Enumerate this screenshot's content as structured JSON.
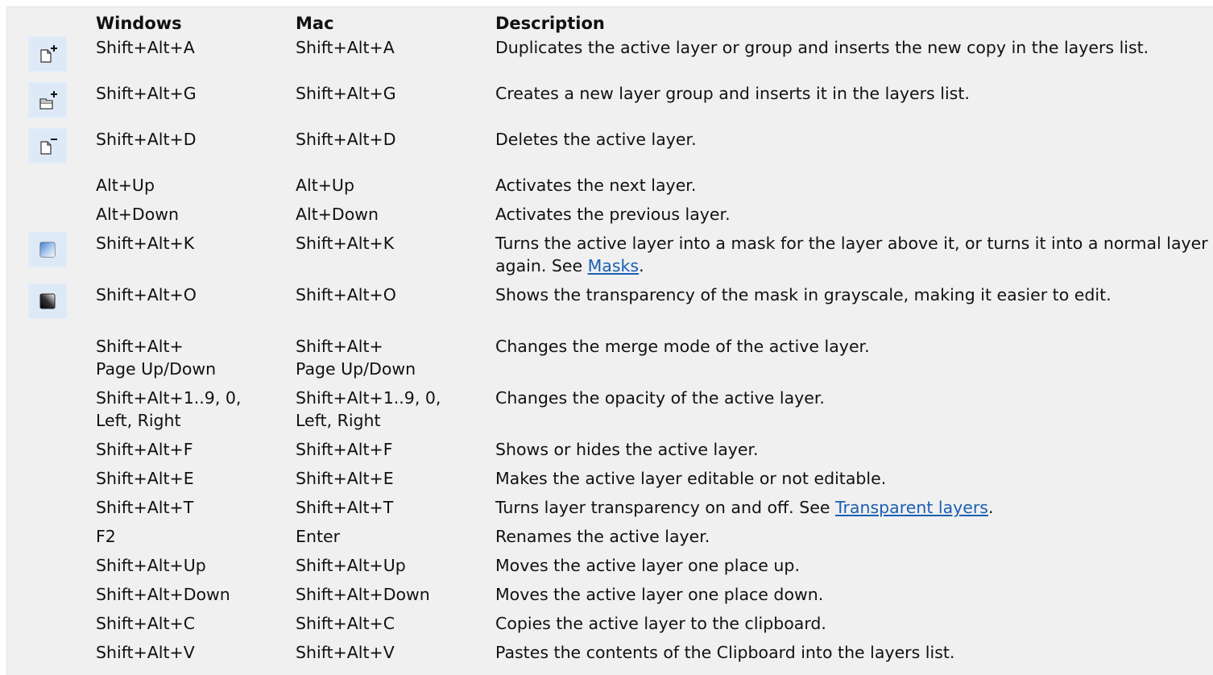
{
  "header": {
    "windows": "Windows",
    "mac": "Mac",
    "description": "Description"
  },
  "rows": [
    {
      "icon": "duplicate-layer-icon",
      "windows": "Shift+Alt+A",
      "mac": "Shift+Alt+A",
      "description": "Duplicates the active layer or group and inserts the new copy in the layers list."
    },
    {
      "icon": "new-layer-group-icon",
      "windows": "Shift+Alt+G",
      "mac": "Shift+Alt+G",
      "description": "Creates a new layer group and inserts it in the layers list."
    },
    {
      "icon": "delete-layer-icon",
      "windows": "Shift+Alt+D",
      "mac": "Shift+Alt+D",
      "description": "Deletes the active layer."
    },
    {
      "icon": "",
      "windows": "Alt+Up",
      "mac": "Alt+Up",
      "description": "Activates the next layer."
    },
    {
      "icon": "",
      "windows": "Alt+Down",
      "mac": "Alt+Down",
      "description": "Activates the previous layer."
    },
    {
      "icon": "mask-layer-icon",
      "windows": "Shift+Alt+K",
      "mac": "Shift+Alt+K",
      "description_before": "Turns the active layer into a mask for the layer above it, or turns it into a normal layer again. See ",
      "link": "Masks",
      "description_after": "."
    },
    {
      "icon": "mask-grayscale-icon",
      "windows": "Shift+Alt+O",
      "mac": "Shift+Alt+O",
      "description": "Shows the transparency of the mask in grayscale, making it easier to edit."
    },
    {
      "icon": "",
      "windows_line1": "Shift+Alt+",
      "windows_line2": "Page Up/Down",
      "mac_line1": "Shift+Alt+",
      "mac_line2": "Page Up/Down",
      "description": "Changes the merge mode of the active layer."
    },
    {
      "icon": "",
      "windows_line1": "Shift+Alt+1..9, 0,",
      "windows_line2": "Left, Right",
      "mac_line1": "Shift+Alt+1..9, 0,",
      "mac_line2": "Left, Right",
      "description": "Changes the opacity of the active layer."
    },
    {
      "icon": "",
      "windows": "Shift+Alt+F",
      "mac": "Shift+Alt+F",
      "description": "Shows or hides the active layer."
    },
    {
      "icon": "",
      "windows": "Shift+Alt+E",
      "mac": "Shift+Alt+E",
      "description": "Makes the active layer editable or not editable."
    },
    {
      "icon": "",
      "windows": "Shift+Alt+T",
      "mac": "Shift+Alt+T",
      "description_before": "Turns layer transparency on and off. See ",
      "link": "Transparent layers",
      "description_after": "."
    },
    {
      "icon": "",
      "windows": "F2",
      "mac": "Enter",
      "description": "Renames the active layer."
    },
    {
      "icon": "",
      "windows": "Shift+Alt+Up",
      "mac": "Shift+Alt+Up",
      "description": "Moves the active layer one place up."
    },
    {
      "icon": "",
      "windows": "Shift+Alt+Down",
      "mac": "Shift+Alt+Down",
      "description": "Moves the active layer one place down."
    },
    {
      "icon": "",
      "windows": "Shift+Alt+C",
      "mac": "Shift+Alt+C",
      "description": "Copies the active layer to the clipboard."
    },
    {
      "icon": "",
      "windows": "Shift+Alt+V",
      "mac": "Shift+Alt+V",
      "description": "Pastes the contents of the Clipboard into the layers list."
    }
  ],
  "colors": {
    "panel_background": "#f0f0f0",
    "icon_background": "#dde9f6",
    "link": "#1a5fb4",
    "text": "#111111"
  }
}
